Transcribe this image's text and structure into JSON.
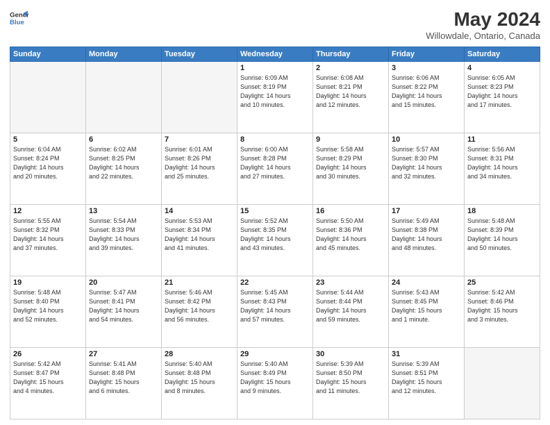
{
  "header": {
    "logo_line1": "General",
    "logo_line2": "Blue",
    "month": "May 2024",
    "location": "Willowdale, Ontario, Canada"
  },
  "weekdays": [
    "Sunday",
    "Monday",
    "Tuesday",
    "Wednesday",
    "Thursday",
    "Friday",
    "Saturday"
  ],
  "weeks": [
    [
      {
        "day": "",
        "info": ""
      },
      {
        "day": "",
        "info": ""
      },
      {
        "day": "",
        "info": ""
      },
      {
        "day": "1",
        "info": "Sunrise: 6:09 AM\nSunset: 8:19 PM\nDaylight: 14 hours\nand 10 minutes."
      },
      {
        "day": "2",
        "info": "Sunrise: 6:08 AM\nSunset: 8:21 PM\nDaylight: 14 hours\nand 12 minutes."
      },
      {
        "day": "3",
        "info": "Sunrise: 6:06 AM\nSunset: 8:22 PM\nDaylight: 14 hours\nand 15 minutes."
      },
      {
        "day": "4",
        "info": "Sunrise: 6:05 AM\nSunset: 8:23 PM\nDaylight: 14 hours\nand 17 minutes."
      }
    ],
    [
      {
        "day": "5",
        "info": "Sunrise: 6:04 AM\nSunset: 8:24 PM\nDaylight: 14 hours\nand 20 minutes."
      },
      {
        "day": "6",
        "info": "Sunrise: 6:02 AM\nSunset: 8:25 PM\nDaylight: 14 hours\nand 22 minutes."
      },
      {
        "day": "7",
        "info": "Sunrise: 6:01 AM\nSunset: 8:26 PM\nDaylight: 14 hours\nand 25 minutes."
      },
      {
        "day": "8",
        "info": "Sunrise: 6:00 AM\nSunset: 8:28 PM\nDaylight: 14 hours\nand 27 minutes."
      },
      {
        "day": "9",
        "info": "Sunrise: 5:58 AM\nSunset: 8:29 PM\nDaylight: 14 hours\nand 30 minutes."
      },
      {
        "day": "10",
        "info": "Sunrise: 5:57 AM\nSunset: 8:30 PM\nDaylight: 14 hours\nand 32 minutes."
      },
      {
        "day": "11",
        "info": "Sunrise: 5:56 AM\nSunset: 8:31 PM\nDaylight: 14 hours\nand 34 minutes."
      }
    ],
    [
      {
        "day": "12",
        "info": "Sunrise: 5:55 AM\nSunset: 8:32 PM\nDaylight: 14 hours\nand 37 minutes."
      },
      {
        "day": "13",
        "info": "Sunrise: 5:54 AM\nSunset: 8:33 PM\nDaylight: 14 hours\nand 39 minutes."
      },
      {
        "day": "14",
        "info": "Sunrise: 5:53 AM\nSunset: 8:34 PM\nDaylight: 14 hours\nand 41 minutes."
      },
      {
        "day": "15",
        "info": "Sunrise: 5:52 AM\nSunset: 8:35 PM\nDaylight: 14 hours\nand 43 minutes."
      },
      {
        "day": "16",
        "info": "Sunrise: 5:50 AM\nSunset: 8:36 PM\nDaylight: 14 hours\nand 45 minutes."
      },
      {
        "day": "17",
        "info": "Sunrise: 5:49 AM\nSunset: 8:38 PM\nDaylight: 14 hours\nand 48 minutes."
      },
      {
        "day": "18",
        "info": "Sunrise: 5:48 AM\nSunset: 8:39 PM\nDaylight: 14 hours\nand 50 minutes."
      }
    ],
    [
      {
        "day": "19",
        "info": "Sunrise: 5:48 AM\nSunset: 8:40 PM\nDaylight: 14 hours\nand 52 minutes."
      },
      {
        "day": "20",
        "info": "Sunrise: 5:47 AM\nSunset: 8:41 PM\nDaylight: 14 hours\nand 54 minutes."
      },
      {
        "day": "21",
        "info": "Sunrise: 5:46 AM\nSunset: 8:42 PM\nDaylight: 14 hours\nand 56 minutes."
      },
      {
        "day": "22",
        "info": "Sunrise: 5:45 AM\nSunset: 8:43 PM\nDaylight: 14 hours\nand 57 minutes."
      },
      {
        "day": "23",
        "info": "Sunrise: 5:44 AM\nSunset: 8:44 PM\nDaylight: 14 hours\nand 59 minutes."
      },
      {
        "day": "24",
        "info": "Sunrise: 5:43 AM\nSunset: 8:45 PM\nDaylight: 15 hours\nand 1 minute."
      },
      {
        "day": "25",
        "info": "Sunrise: 5:42 AM\nSunset: 8:46 PM\nDaylight: 15 hours\nand 3 minutes."
      }
    ],
    [
      {
        "day": "26",
        "info": "Sunrise: 5:42 AM\nSunset: 8:47 PM\nDaylight: 15 hours\nand 4 minutes."
      },
      {
        "day": "27",
        "info": "Sunrise: 5:41 AM\nSunset: 8:48 PM\nDaylight: 15 hours\nand 6 minutes."
      },
      {
        "day": "28",
        "info": "Sunrise: 5:40 AM\nSunset: 8:48 PM\nDaylight: 15 hours\nand 8 minutes."
      },
      {
        "day": "29",
        "info": "Sunrise: 5:40 AM\nSunset: 8:49 PM\nDaylight: 15 hours\nand 9 minutes."
      },
      {
        "day": "30",
        "info": "Sunrise: 5:39 AM\nSunset: 8:50 PM\nDaylight: 15 hours\nand 11 minutes."
      },
      {
        "day": "31",
        "info": "Sunrise: 5:39 AM\nSunset: 8:51 PM\nDaylight: 15 hours\nand 12 minutes."
      },
      {
        "day": "",
        "info": ""
      }
    ]
  ]
}
